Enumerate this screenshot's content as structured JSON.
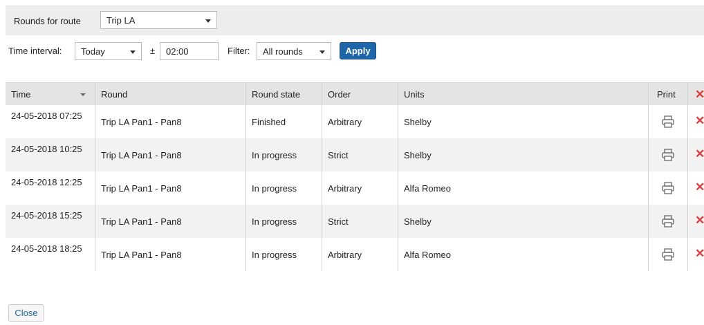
{
  "route": {
    "label": "Rounds for route",
    "selected": "Trip LA"
  },
  "filters": {
    "time_interval_label": "Time interval:",
    "time_interval_value": "Today",
    "plus_minus": "±",
    "offset_value": "02:00",
    "filter_label": "Filter:",
    "filter_value": "All rounds",
    "apply_label": "Apply"
  },
  "table": {
    "headers": {
      "time": "Time",
      "round": "Round",
      "state": "Round state",
      "order": "Order",
      "units": "Units",
      "print": "Print"
    },
    "rows": [
      {
        "time": "24-05-2018 07:25",
        "round": "Trip LA Pan1 - Pan8",
        "state": "Finished",
        "order": "Arbitrary",
        "units": "Shelby"
      },
      {
        "time": "24-05-2018 10:25",
        "round": "Trip LA Pan1 - Pan8",
        "state": "In progress",
        "order": "Strict",
        "units": "Shelby"
      },
      {
        "time": "24-05-2018 12:25",
        "round": "Trip LA Pan1 - Pan8",
        "state": "In progress",
        "order": "Arbitrary",
        "units": "Alfa Romeo"
      },
      {
        "time": "24-05-2018 15:25",
        "round": "Trip LA Pan1 - Pan8",
        "state": "In progress",
        "order": "Strict",
        "units": "Shelby"
      },
      {
        "time": "24-05-2018 18:25",
        "round": "Trip LA Pan1 - Pan8",
        "state": "In progress",
        "order": "Arbitrary",
        "units": "Alfa Romeo"
      }
    ]
  },
  "icons": {
    "print": "printer-icon",
    "delete": "delete-icon",
    "dropdown": "chevron-down-icon"
  },
  "colors": {
    "accent": "#1c66a9",
    "delete": "#e03a3a"
  },
  "close_label": "Close"
}
